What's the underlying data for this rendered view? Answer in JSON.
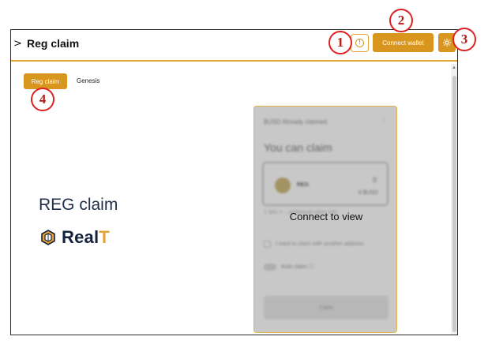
{
  "header": {
    "chevron": ">",
    "title": "Reg claim",
    "connect_label": "Connect wallet"
  },
  "tabs": [
    {
      "label": "Reg claim",
      "active": true
    },
    {
      "label": "Genesis",
      "active": false
    }
  ],
  "main": {
    "heading": "REG claim",
    "logo_text_main": "Real",
    "logo_text_accent": "T"
  },
  "claim_card": {
    "already_claimed": "$USD Already claimed",
    "dots": "⋮",
    "you_can_claim": "You can claim",
    "token": "REG",
    "amount": "0",
    "amount_usd": "0 $USD",
    "hint": "1 Wei = ...additional claim info",
    "other_address": "I want to claim with another address",
    "auto_claim": "Auto claim ⓘ",
    "claim_button": "Claim",
    "overlay": "Connect to view"
  },
  "annotations": [
    "1",
    "2",
    "3",
    "4"
  ],
  "colors": {
    "accent": "#d9961f",
    "marker": "#e02020",
    "logo_navy": "#14233d"
  },
  "icons": [
    "warning-icon",
    "gear-icon",
    "chevron-right-icon",
    "realt-logo-icon"
  ]
}
